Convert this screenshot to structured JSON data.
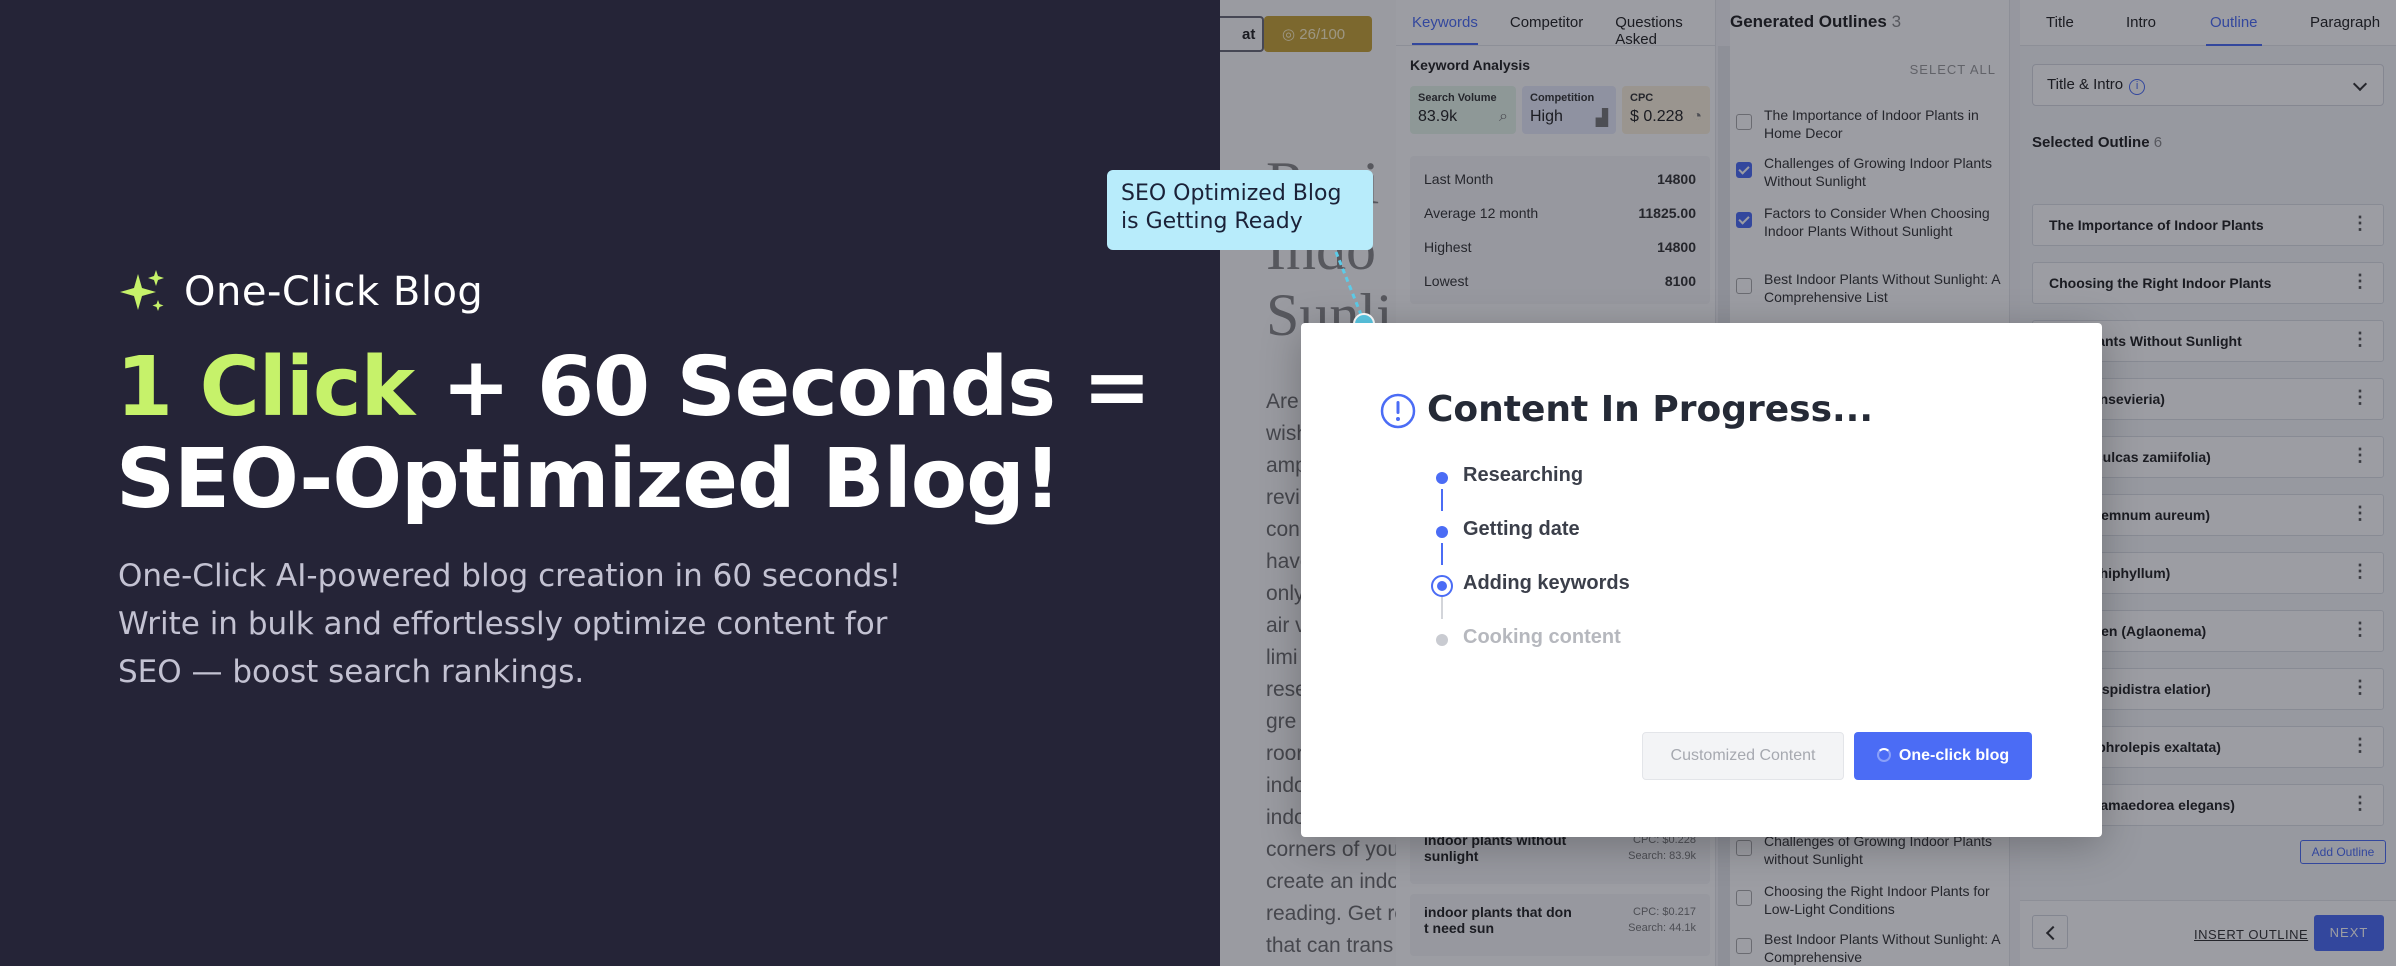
{
  "hero": {
    "brand_name": "One-Click Blog",
    "headline_accent": "1 Click",
    "headline_rest_1": " + 60 Seconds =",
    "headline_line_2": "SEO-Optimized Blog!",
    "subtext": "One-Click AI-powered blog creation in 60 seconds! Write in bulk and effortlessly optimize content for SEO — boost search rankings.",
    "accent_color": "#c6f26a",
    "background_color": "#252437"
  },
  "editor": {
    "chip_label": "at",
    "score": "26/100",
    "title": "Revi Indo Sunli",
    "body_lines": [
      "Are",
      "wish",
      "amp",
      "revi",
      "con",
      "have",
      "only",
      "air v",
      "limi",
      "rese",
      "gre",
      "roor",
      "indo",
      "indo",
      "corners of you",
      "create an indo",
      "reading. Get re",
      "that can trans"
    ]
  },
  "keywords_panel": {
    "tabs": [
      "Keywords",
      "Competitor",
      "Questions Asked"
    ],
    "active_tab": "Keywords",
    "section_title": "Keyword Analysis",
    "stats": [
      {
        "label": "Search Volume",
        "value": "83.9k"
      },
      {
        "label": "Competition",
        "value": "High"
      },
      {
        "label": "CPC",
        "value": "$ 0.228"
      }
    ],
    "metrics": [
      {
        "label": "Last Month",
        "value": "14800"
      },
      {
        "label": "Average 12 month",
        "value": "11825.00"
      },
      {
        "label": "Highest",
        "value": "14800"
      },
      {
        "label": "Lowest",
        "value": "8100"
      }
    ],
    "keywords": [
      {
        "name": "indoor plants without sunlight",
        "cpc": "CPC: $0.228",
        "search": "Search: 83.9k"
      },
      {
        "name": "indoor plants that don t need sun",
        "cpc": "CPC: $0.217",
        "search": "Search: 44.1k"
      }
    ]
  },
  "outlines_panel": {
    "title": "Generated Outlines",
    "count": "3",
    "select_all": "SELECT ALL",
    "top_items": [
      {
        "text": "The Importance of Indoor Plants in Home Decor",
        "checked": false
      },
      {
        "text": "Challenges of Growing Indoor Plants Without Sunlight",
        "checked": true
      },
      {
        "text": "Factors to Consider When Choosing Indoor Plants Without Sunlight",
        "checked": true
      },
      {
        "text": "Best Indoor Plants Without Sunlight: A Comprehensive List",
        "checked": false
      }
    ],
    "bottom_items": [
      {
        "text": "Challenges of Growing Indoor Plants without Sunlight",
        "checked": false
      },
      {
        "text": "Choosing the Right Indoor Plants for Low-Light Conditions",
        "checked": false
      },
      {
        "text": "Best Indoor Plants Without Sunlight: A Comprehensive",
        "checked": false
      }
    ]
  },
  "outline_panel": {
    "tabs": [
      "Title",
      "Intro",
      "Outline",
      "Paragraph"
    ],
    "active_tab": "Outline",
    "dropdown_value": "Title & Intro",
    "info_glyph": "i",
    "selected_title": "Selected Outline",
    "selected_count": "6",
    "items": [
      "The Importance of Indoor Plants",
      "Choosing the Right Indoor Plants",
      "door Plants Without Sunlight",
      "lant (Sansevieria)",
      "(Zamioculcas zamiifolia)",
      "y (Epipremnum aureum)",
      "ly (Spathiphyllum)",
      "Evergreen (Aglaonema)",
      "Plant (Aspidistra elatior)",
      "ern (Nephrolepis exaltata)",
      "alm (Chamaedorea elegans)"
    ],
    "add_outline": "Add Outline",
    "insert_outline": "INSERT OUTLINE",
    "next": "NEXT"
  },
  "tooltip": {
    "text": "SEO Optimized Blog is Getting Ready"
  },
  "modal": {
    "title": "Content In Progress...",
    "icon_glyph": "!",
    "steps": [
      {
        "label": "Researching",
        "status": "done"
      },
      {
        "label": "Getting date",
        "status": "done"
      },
      {
        "label": "Adding keywords",
        "status": "active"
      },
      {
        "label": "Cooking content",
        "status": "pending"
      }
    ],
    "secondary_button": "Customized Content",
    "primary_button": "One-click blog",
    "primary_color": "#4b6cf5"
  }
}
